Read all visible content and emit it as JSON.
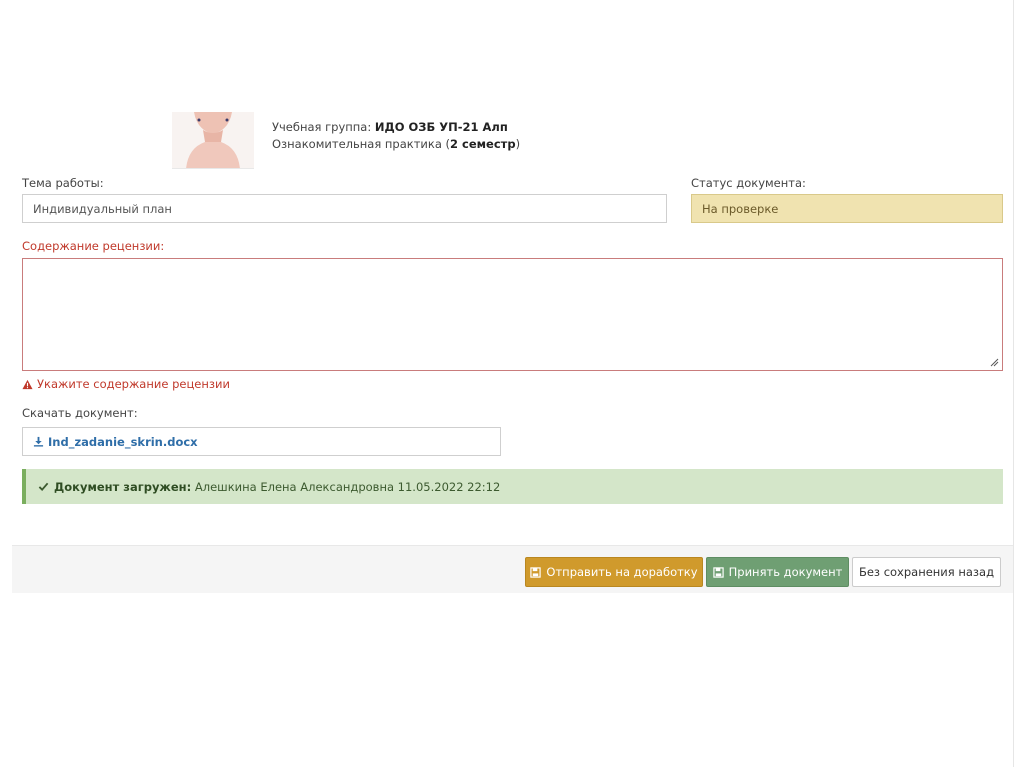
{
  "header": {
    "group_label": "Учебная группа: ",
    "group_value": "ИДО ОЗБ УП-21 Алп",
    "practice_prefix": "Ознакомительная практика (",
    "practice_semester": "2 семестр",
    "practice_suffix": ")"
  },
  "form": {
    "topic_label": "Тема работы:",
    "topic_value": "Индивидуальный план",
    "status_label": "Статус документа:",
    "status_value": "На проверке",
    "review_label": "Содержание рецензии:",
    "review_value": "",
    "review_error": "Укажите содержание рецензии",
    "download_label": "Скачать документ:",
    "download_file": "Ind_zadanie_skrin.docx"
  },
  "alert": {
    "bold": "Документ загружен:",
    "text": " Алешкина Елена Александровна 11.05.2022 22:12"
  },
  "actions": {
    "return_label": "Отправить на доработку",
    "accept_label": "Принять документ",
    "back_label": "Без сохранения назад"
  },
  "colors": {
    "warning": "#d09a2c",
    "success": "#6f9f73",
    "error": "#c0392b",
    "status_bg": "#f0e3b0",
    "alert_bg": "#d4e6c9"
  },
  "icons": {
    "error": "warning-triangle-icon",
    "download": "download-icon",
    "alert": "check-icon",
    "save": "floppy-disk-icon"
  }
}
